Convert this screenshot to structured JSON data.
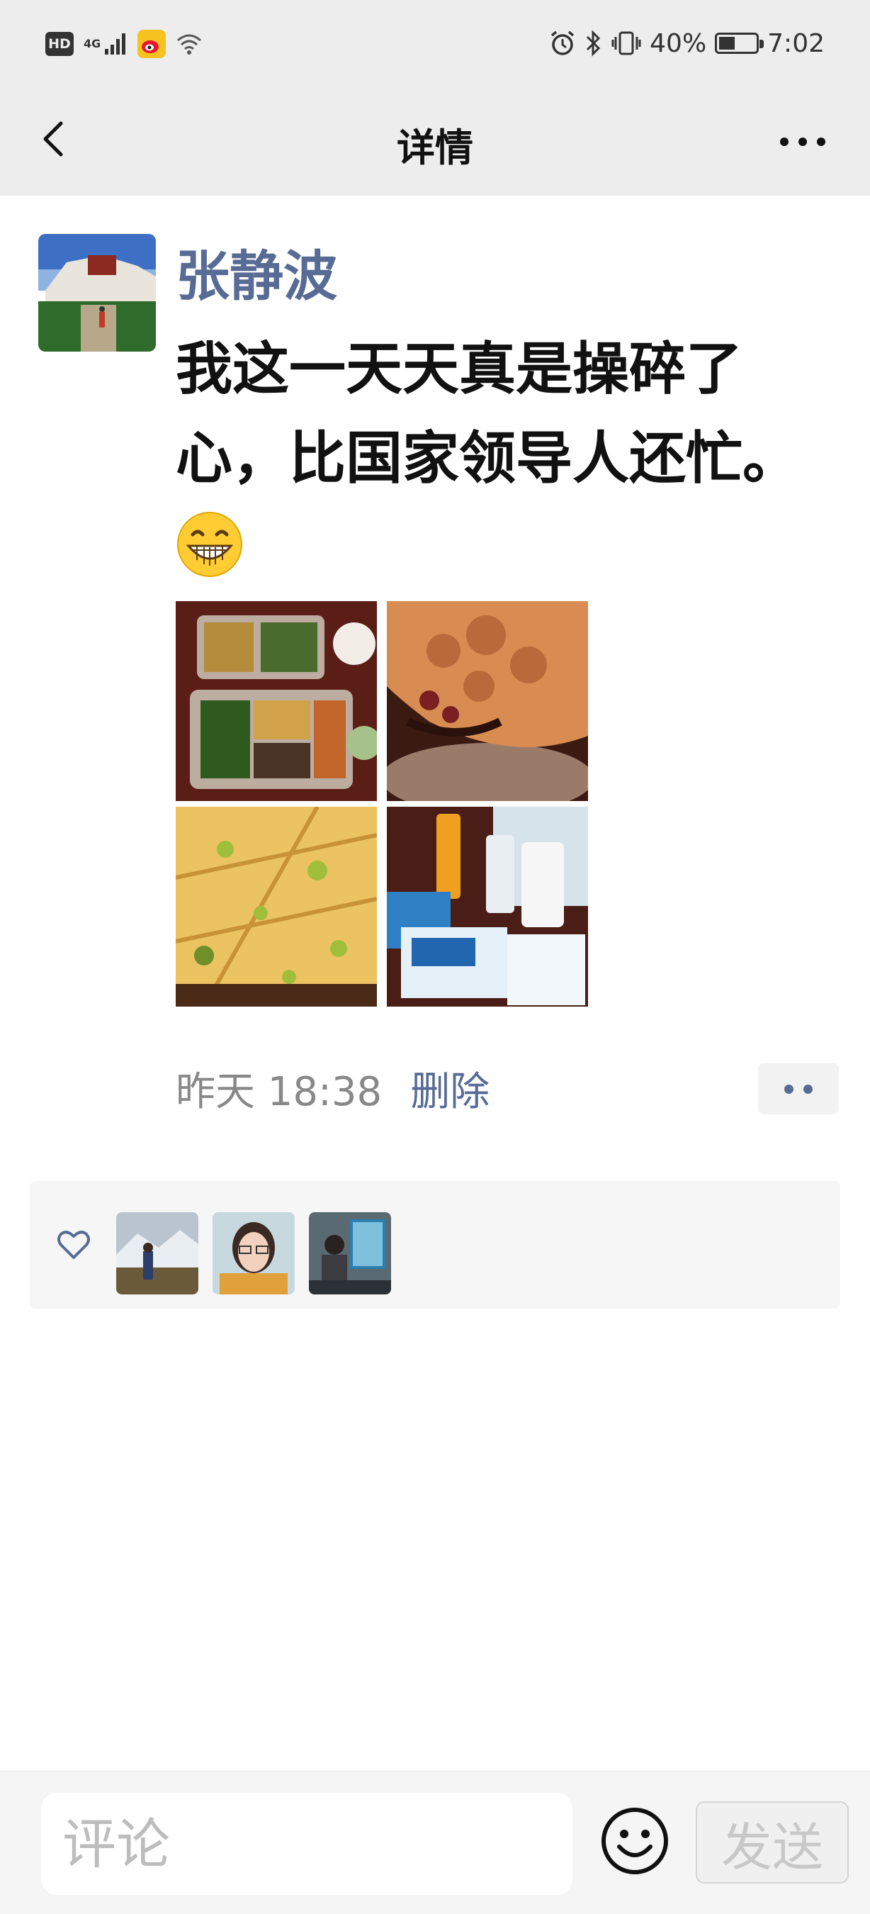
{
  "status_bar": {
    "hd": "HD",
    "network": "4G",
    "battery_percent": "40%",
    "battery_level": 0.4,
    "time": "7:02",
    "icons": [
      "weibo-icon",
      "wifi-icon",
      "alarm-icon",
      "bluetooth-icon",
      "vibrate-icon",
      "battery-icon"
    ]
  },
  "nav": {
    "title": "详情",
    "back_icon": "chevron-left-icon",
    "more_icon": "more-dots-icon"
  },
  "post": {
    "author": "张静波",
    "text": "我这一天天真是操碎了心，比国家领导人还忙。",
    "emoji": "grinning-face-icon",
    "photos": [
      "bento-meal",
      "lotus-root-dish",
      "scallion-pancake",
      "supplies-bottles"
    ],
    "timestamp": "昨天 18:38",
    "delete_label": "删除"
  },
  "likes": {
    "icon": "heart-icon",
    "likers": [
      "liker-1",
      "liker-2",
      "liker-3"
    ]
  },
  "comment_bar": {
    "placeholder": "评论",
    "send_label": "发送"
  },
  "colors": {
    "link_blue": "#576b95",
    "bar_gray": "#ededed"
  }
}
